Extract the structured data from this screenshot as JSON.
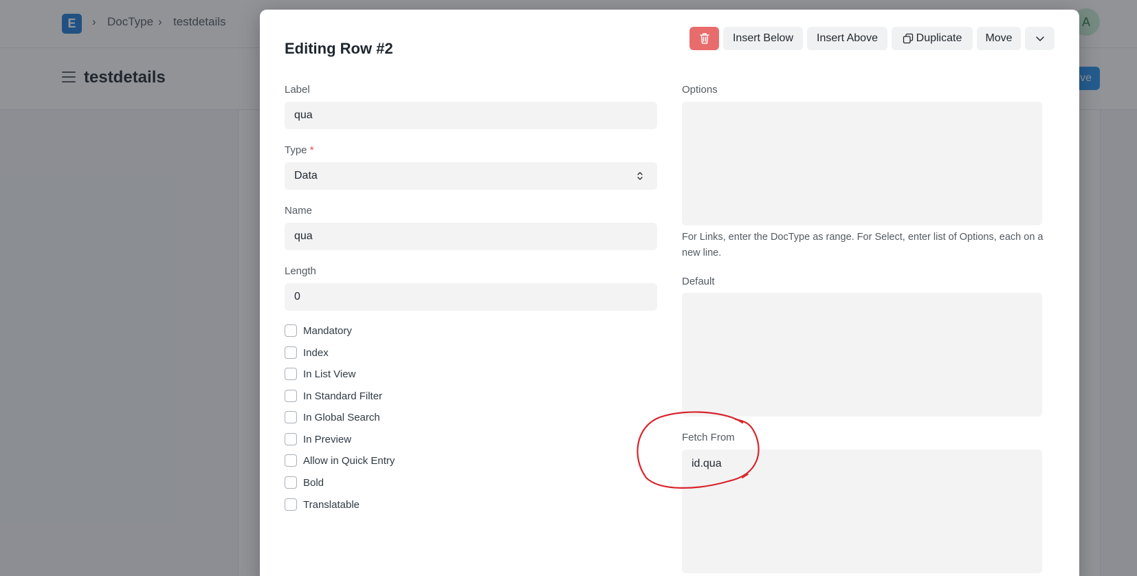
{
  "app": {
    "logo_letter": "E",
    "breadcrumb": [
      "DocType",
      "testdetails"
    ],
    "page_title": "testdetails",
    "avatar_initial": "A",
    "primary_action_label": "ve"
  },
  "modal": {
    "title": "Editing Row #2",
    "actions": {
      "delete_icon": "trash-icon",
      "insert_below": "Insert Below",
      "insert_above": "Insert Above",
      "duplicate": "Duplicate",
      "duplicate_icon": "duplicate-icon",
      "move": "Move",
      "more_icon": "chevron-down-icon"
    },
    "left": {
      "label": {
        "label": "Label",
        "value": "qua"
      },
      "type": {
        "label": "Type",
        "required": "*",
        "value": "Data"
      },
      "name": {
        "label": "Name",
        "value": "qua"
      },
      "length": {
        "label": "Length",
        "value": "0"
      },
      "checkboxes": [
        {
          "label": "Mandatory",
          "checked": false
        },
        {
          "label": "Index",
          "checked": false
        },
        {
          "label": "In List View",
          "checked": false
        },
        {
          "label": "In Standard Filter",
          "checked": false
        },
        {
          "label": "In Global Search",
          "checked": false
        },
        {
          "label": "In Preview",
          "checked": false
        },
        {
          "label": "Allow in Quick Entry",
          "checked": false
        },
        {
          "label": "Bold",
          "checked": false
        },
        {
          "label": "Translatable",
          "checked": false
        }
      ]
    },
    "right": {
      "options": {
        "label": "Options",
        "value": "",
        "help": "For Links, enter the DocType as range. For Select, enter list of Options, each on a new line."
      },
      "default": {
        "label": "Default",
        "value": ""
      },
      "fetch_from": {
        "label": "Fetch From",
        "value": "id.qua"
      }
    }
  },
  "colors": {
    "brand": "#1f7bd6",
    "primary": "#2490ef",
    "danger": "#e86c6c",
    "annotation": "#d9232a"
  }
}
